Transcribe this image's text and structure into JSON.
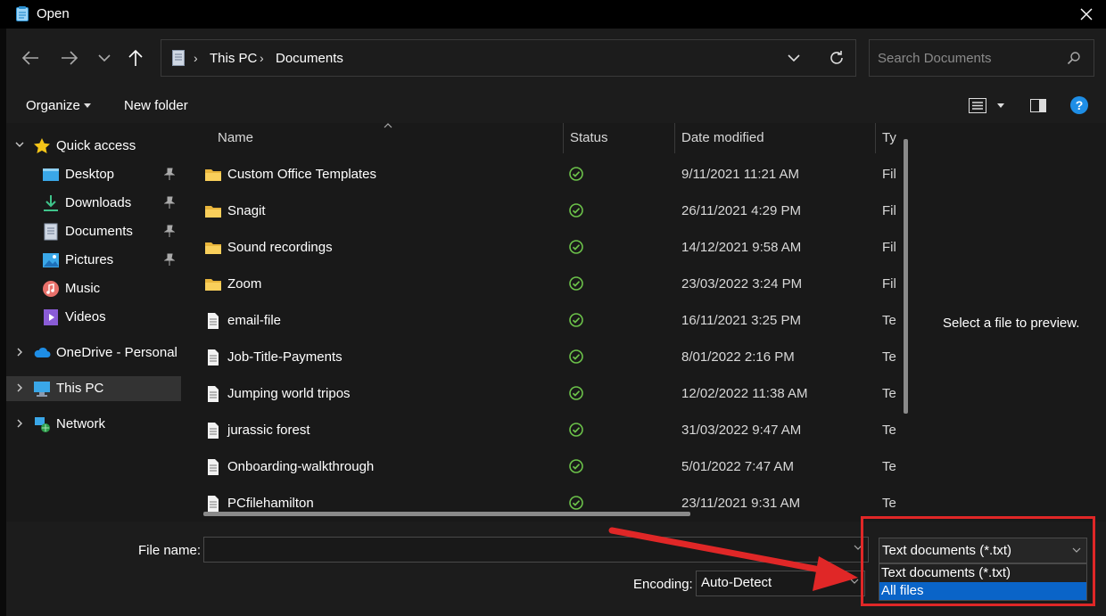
{
  "window": {
    "title": "Open"
  },
  "nav": {
    "breadcrumb": [
      "This PC",
      "Documents"
    ],
    "search_placeholder": "Search Documents"
  },
  "toolbar": {
    "organize": "Organize",
    "new_folder": "New folder"
  },
  "sidebar": {
    "items": [
      {
        "label": "Quick access",
        "icon": "star-icon"
      },
      {
        "label": "Desktop",
        "icon": "desktop-icon"
      },
      {
        "label": "Downloads",
        "icon": "download-icon"
      },
      {
        "label": "Documents",
        "icon": "documents-icon"
      },
      {
        "label": "Pictures",
        "icon": "pictures-icon"
      },
      {
        "label": "Music",
        "icon": "music-icon"
      },
      {
        "label": "Videos",
        "icon": "videos-icon"
      },
      {
        "label": "OneDrive - Personal",
        "icon": "cloud-icon"
      },
      {
        "label": "This PC",
        "icon": "computer-icon"
      },
      {
        "label": "Network",
        "icon": "network-icon"
      }
    ]
  },
  "files": {
    "columns": [
      "Name",
      "Status",
      "Date modified",
      "Ty"
    ],
    "rows": [
      {
        "name": "Custom Office Templates",
        "date": "9/11/2021 11:21 AM",
        "type": "Fil",
        "kind": "folder"
      },
      {
        "name": "Snagit",
        "date": "26/11/2021 4:29 PM",
        "type": "Fil",
        "kind": "folder"
      },
      {
        "name": "Sound recordings",
        "date": "14/12/2021 9:58 AM",
        "type": "Fil",
        "kind": "folder"
      },
      {
        "name": "Zoom",
        "date": "23/03/2022 3:24 PM",
        "type": "Fil",
        "kind": "folder"
      },
      {
        "name": "email-file",
        "date": "16/11/2021 3:25 PM",
        "type": "Te",
        "kind": "file"
      },
      {
        "name": "Job-Title-Payments",
        "date": "8/01/2022 2:16 PM",
        "type": "Te",
        "kind": "file"
      },
      {
        "name": "Jumping world tripos",
        "date": "12/02/2022 11:38 AM",
        "type": "Te",
        "kind": "file"
      },
      {
        "name": "jurassic forest",
        "date": "31/03/2022 9:47 AM",
        "type": "Te",
        "kind": "file"
      },
      {
        "name": "Onboarding-walkthrough",
        "date": "5/01/2022 7:47 AM",
        "type": "Te",
        "kind": "file"
      },
      {
        "name": "PCfilehamilton",
        "date": "23/11/2021 9:31 AM",
        "type": "Te",
        "kind": "file"
      }
    ]
  },
  "preview": {
    "text": "Select a file to preview."
  },
  "bottom": {
    "file_name_label": "File name:",
    "file_name_value": "",
    "encoding_label": "Encoding:",
    "encoding_value": "Auto-Detect",
    "filter_selected": "Text documents (*.txt)",
    "filter_options": [
      "Text documents (*.txt)",
      "All files"
    ]
  },
  "colors": {
    "accent": "#0a64c8",
    "annotation": "#e02727",
    "status_ok": "#6cc24a"
  }
}
